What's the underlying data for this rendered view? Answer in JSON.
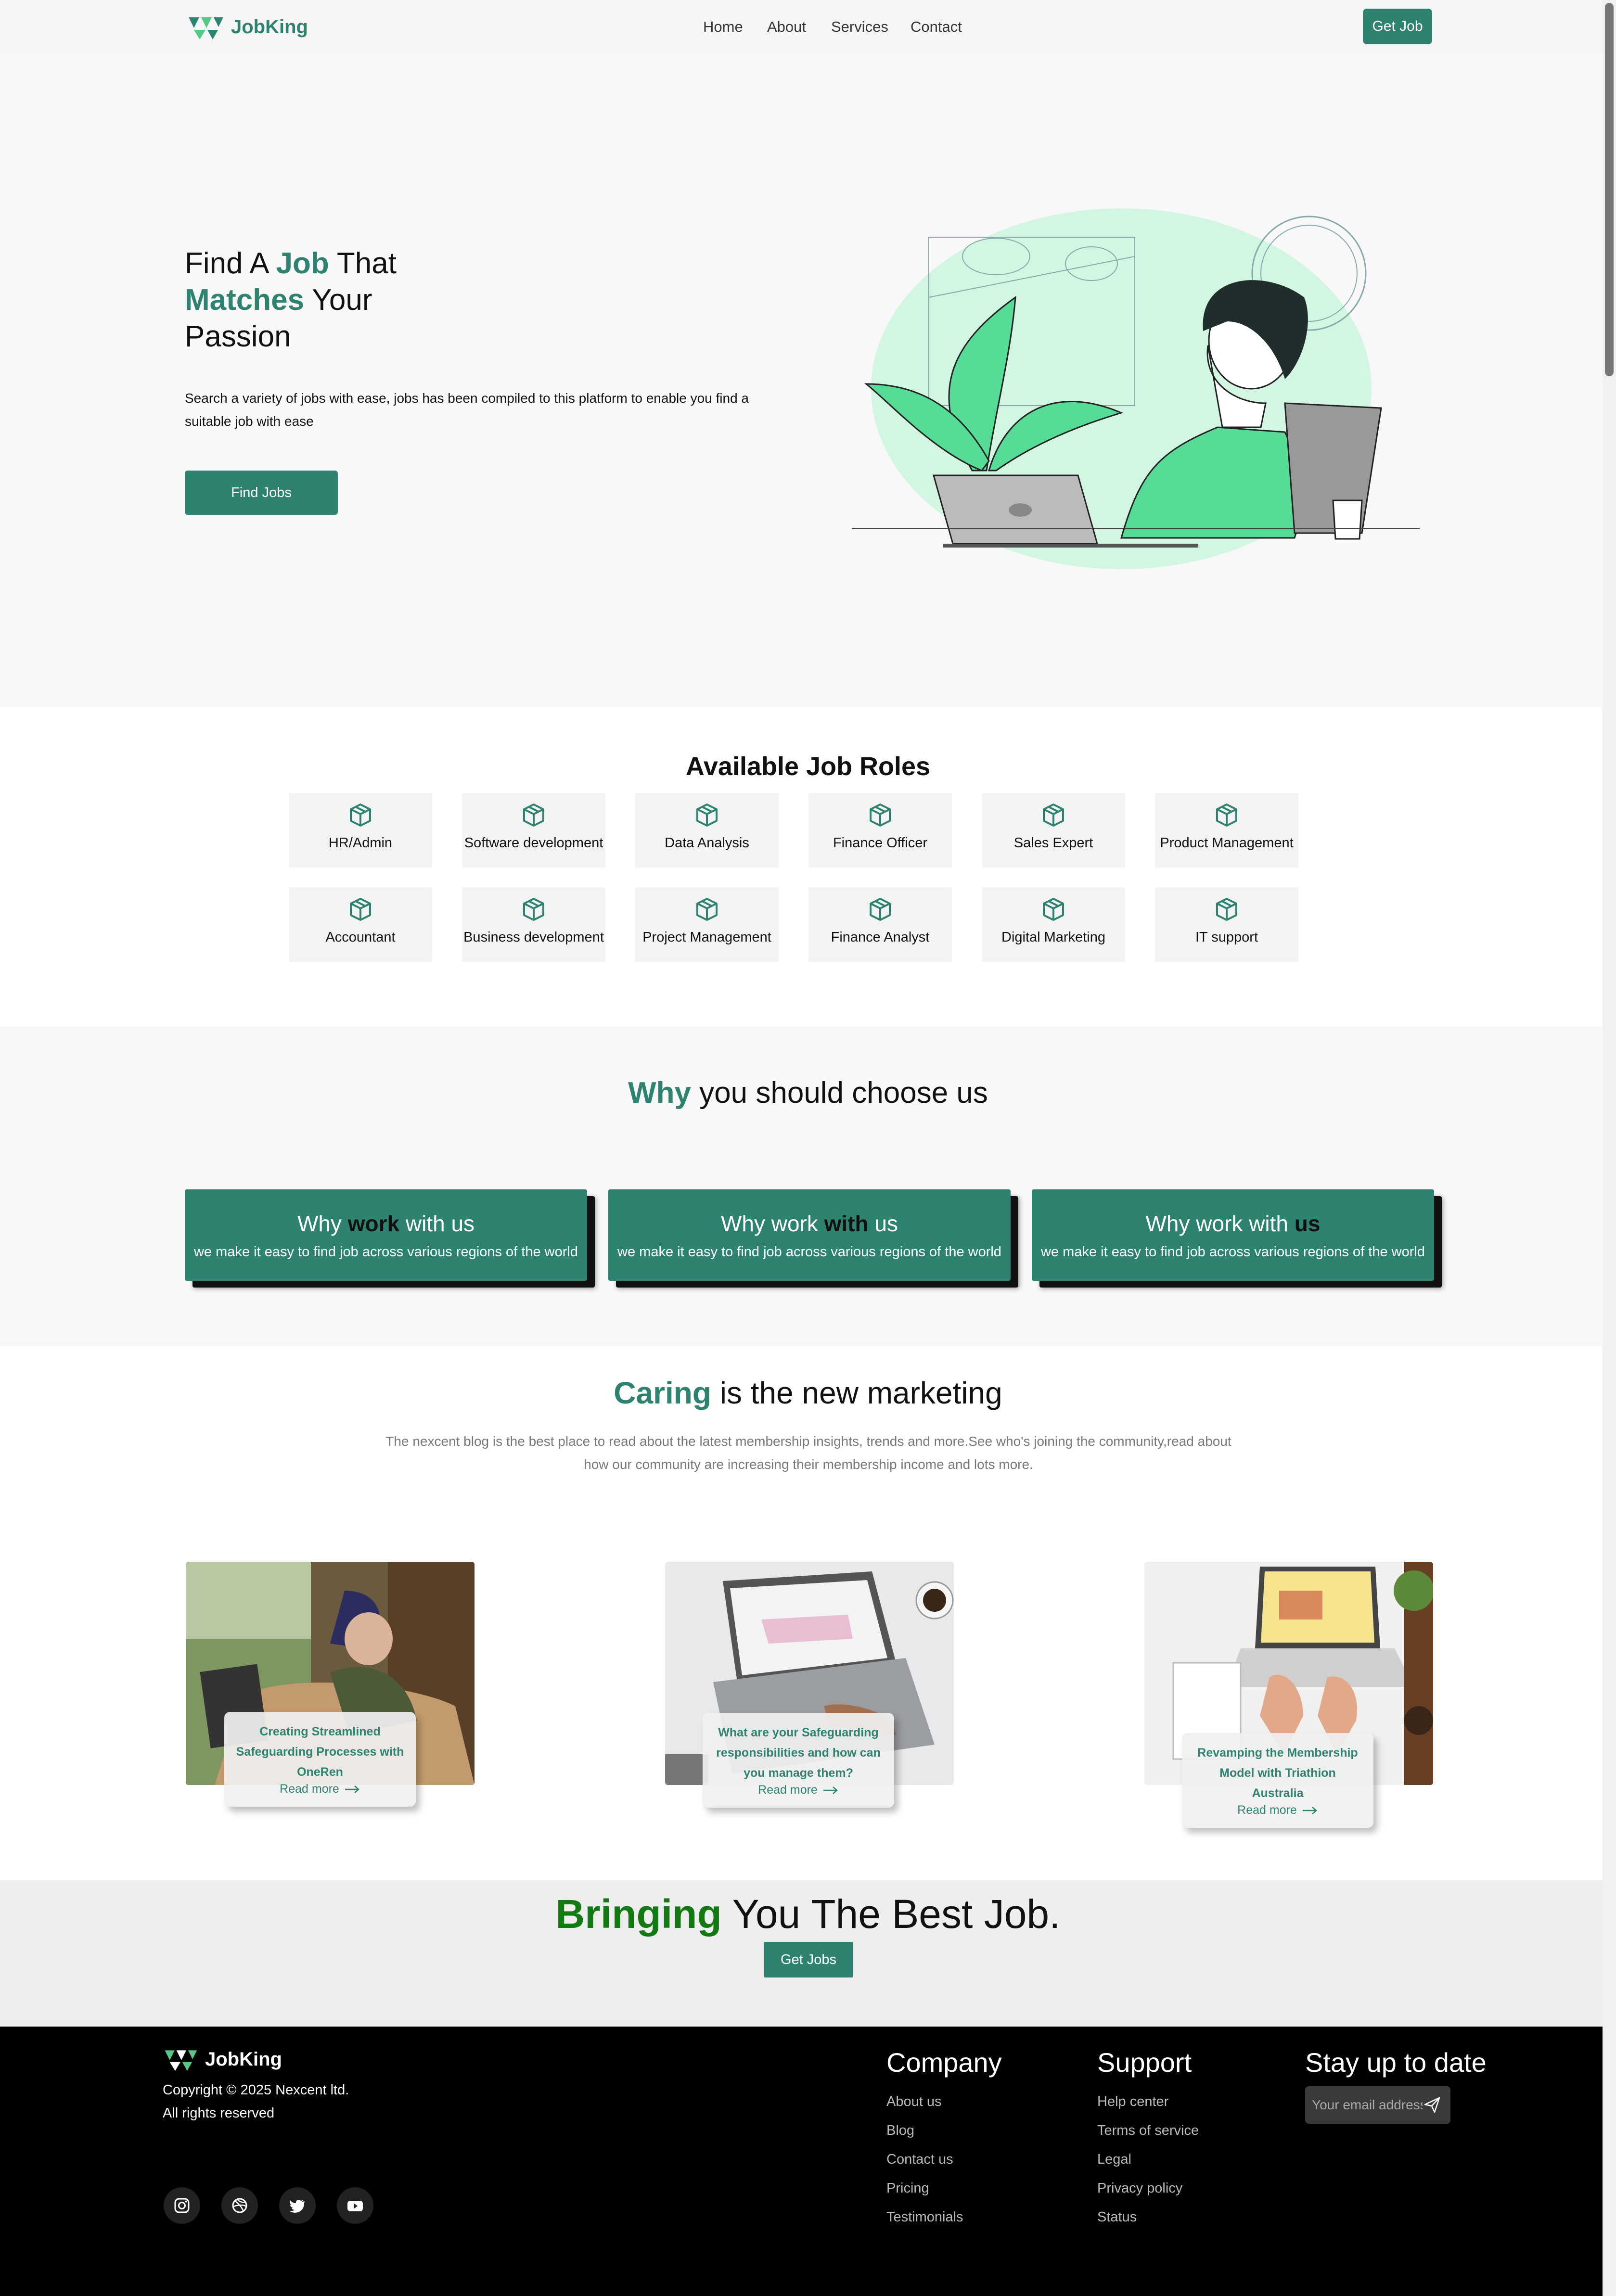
{
  "brand": {
    "name": "JobKing",
    "accent": "#2e8270",
    "dark_green": "#137a13"
  },
  "nav": {
    "links": [
      "Home",
      "About",
      "Services",
      "Contact"
    ],
    "cta": "Get Job"
  },
  "hero": {
    "title_1": "Find A ",
    "title_accent_1": "Job",
    "title_2": " That",
    "title_accent_2": "Matches",
    "title_3": " Your",
    "title_4": "Passion",
    "description": "Search a variety of jobs with ease, jobs has been compiled to this platform to enable you find a suitable job with ease",
    "button": "Find Jobs"
  },
  "roles": {
    "title": "Available Job Roles",
    "icon": "cube-icon",
    "items": [
      "HR/Admin",
      "Software development",
      "Data Analysis",
      "Finance Officer",
      "Sales Expert",
      "Product Management",
      "Accountant",
      "Business development",
      "Project Management",
      "Finance Analyst",
      "Digital Marketing",
      "IT support"
    ]
  },
  "why": {
    "title_accent": "Why",
    "title_rest": " you should choose us",
    "cards": [
      {
        "pre": "Why ",
        "bold": "work",
        "post": " with us",
        "desc": "we make it easy to find job across various regions of the world"
      },
      {
        "pre": "Why work ",
        "bold": "with",
        "post": " us",
        "desc": "we make it easy to find job across various regions of the world"
      },
      {
        "pre": "Why work with ",
        "bold": "us",
        "post": "",
        "desc": "we make it easy to find job across various regions of the world"
      }
    ]
  },
  "caring": {
    "title_accent": "Caring",
    "title_rest": " is the new marketing",
    "description": "The nexcent blog is the best place to read about the latest membership insights, trends and more.See who's joining the community,read about how our community are increasing their membership income and lots more.",
    "posts": [
      {
        "title": "Creating Streamlined Safeguarding Processes with OneRen",
        "link": "Read more"
      },
      {
        "title": "What are your Safeguarding responsibilities and how can you manage them?",
        "link": "Read more"
      },
      {
        "title": "Revamping the Membership Model with Triathion Australia",
        "link": "Read more"
      }
    ]
  },
  "bring": {
    "title_accent": "Bringing",
    "title_rest": " You The Best Job.",
    "button": "Get Jobs"
  },
  "footer": {
    "brand": "JobKing",
    "copyright": "Copyright © 2025 Nexcent ltd.",
    "rights": "All rights reserved",
    "social": [
      "instagram-icon",
      "dribbble-icon",
      "twitter-icon",
      "youtube-icon"
    ],
    "company": {
      "title": "Company",
      "links": [
        "About us",
        "Blog",
        "Contact us",
        "Pricing",
        "Testimonials"
      ]
    },
    "support": {
      "title": "Support",
      "links": [
        "Help center",
        "Terms of service",
        "Legal",
        "Privacy policy",
        "Status"
      ]
    },
    "newsletter": {
      "title": "Stay up to date",
      "placeholder": "Your email address"
    }
  }
}
